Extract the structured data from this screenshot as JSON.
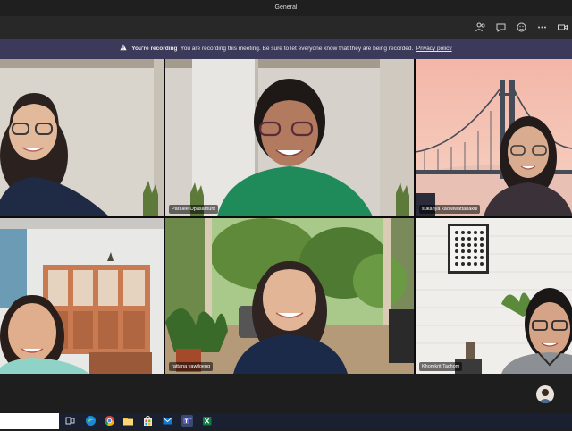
{
  "window": {
    "title": "General"
  },
  "toolbar": {
    "icons": [
      "participants-icon",
      "chat-icon",
      "reactions-icon",
      "more-icon",
      "camera-icon"
    ]
  },
  "recording_banner": {
    "heading": "You're recording",
    "message": "You are recording this meeting. Be sure to let everyone know that they are being recorded.",
    "link": "Privacy policy"
  },
  "participants": [
    {
      "name": ""
    },
    {
      "name": "Paralee Opasamunt"
    },
    {
      "name": "sukanya kaowiwattanakul"
    },
    {
      "name": ""
    },
    {
      "name": "rattana yawiloeng"
    },
    {
      "name": "Khomkrit Tachom"
    }
  ],
  "colors": {
    "banner_bg": "#3b3a5a",
    "app_bg": "#201f1f",
    "taskbar_bg": "#1a2030"
  }
}
